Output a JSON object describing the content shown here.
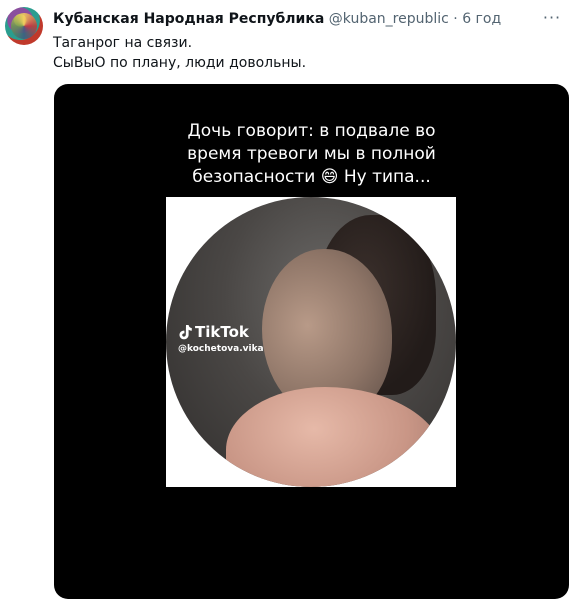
{
  "tweet": {
    "author": "Кубанская Народная Республика",
    "handle": "@kuban_republic",
    "separator": "·",
    "time": "6 год",
    "more_label": "···",
    "text_lines": [
      "Таганрог на связи.",
      "СыВыО по плану, люди довольны."
    ]
  },
  "media": {
    "caption_lines": [
      "Дочь говорит: в подвале во",
      "время тревоги мы в полной",
      "безопасности 😄 Ну типа..."
    ],
    "watermark_brand": "TikTok",
    "watermark_handle": "@kochetova.vika"
  },
  "colors": {
    "text": "#0f1419",
    "secondary": "#536471",
    "media_bg": "#000000"
  },
  "icons": [
    "more-icon",
    "tiktok-icon"
  ]
}
